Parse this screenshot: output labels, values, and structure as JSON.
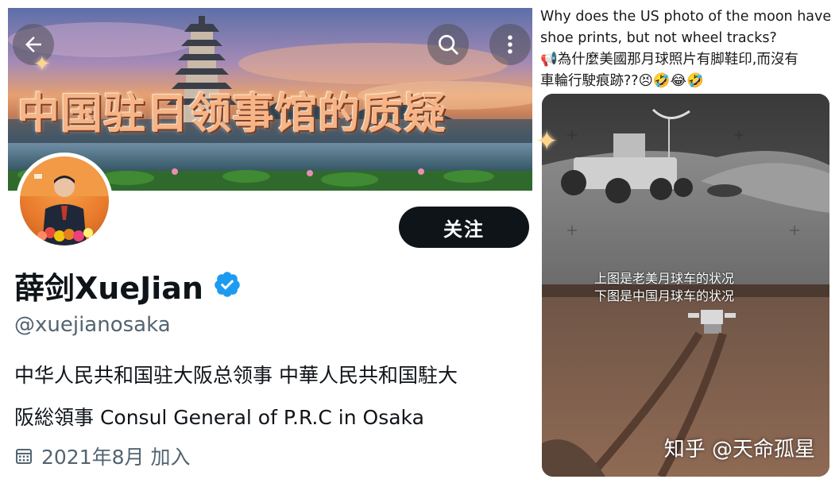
{
  "banner": {
    "overlay_title": "中国驻日领事馆的质疑",
    "back_icon": "arrow-left-icon",
    "search_icon": "search-icon",
    "more_icon": "more-vertical-icon"
  },
  "profile": {
    "follow_label": "关注",
    "display_name": "薛剑XueJian",
    "verified_icon": "verified-badge-icon",
    "handle": "@xuejianosaka",
    "bio_line1": "中华人民共和国驻大阪总领事 中華人民共和国駐大",
    "bio_line2": "阪総領事 Consul General of P.R.C  in Osaka",
    "calendar_icon": "calendar-icon",
    "joined": "2021年8月 加入"
  },
  "post": {
    "text_en_line1": "Why does the US photo of the moon have",
    "text_en_line2": "shoe prints, but not wheel tracks?",
    "text_zh_line1": "📢為什麼美國那月球照片有脚鞋印,而沒有",
    "text_zh_line2": "車輪行駛痕跡??😣🤣😂🤣",
    "caption_top": "上图是老美月球车的状况",
    "caption_bottom": "下图是中国月球车的状况",
    "watermark": "知乎 @天命孤星"
  },
  "colors": {
    "follow_bg": "#0f1419",
    "verified_blue": "#1d9bf0",
    "handle_gray": "#536471"
  }
}
